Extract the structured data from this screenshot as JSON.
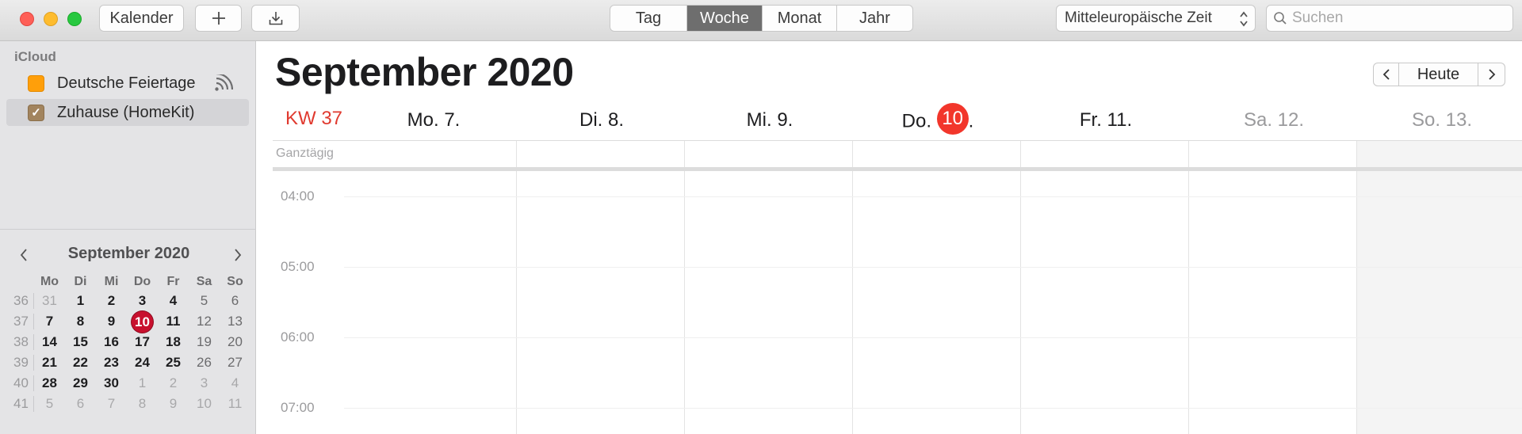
{
  "toolbar": {
    "calendars_button": "Kalender",
    "add_icon": "plus-icon",
    "import_icon": "download-tray-icon",
    "views": [
      "Tag",
      "Woche",
      "Monat",
      "Jahr"
    ],
    "active_view": "Woche",
    "timezone": "Mitteleuropäische Zeit",
    "search_placeholder": "Suchen"
  },
  "sidebar": {
    "account": "iCloud",
    "calendars": [
      {
        "name": "Deutsche Feiertage",
        "color": "#ff9f0a",
        "checked": false,
        "subscribed": true
      },
      {
        "name": "Zuhause (HomeKit)",
        "color": "#a2845e",
        "checked": true,
        "subscribed": false
      }
    ],
    "mini_calendar": {
      "title": "September 2020",
      "weekdays": [
        "Mo",
        "Di",
        "Mi",
        "Do",
        "Fr",
        "Sa",
        "So"
      ],
      "weeks": [
        {
          "wk": "36",
          "days": [
            "31",
            "1",
            "2",
            "3",
            "4",
            "5",
            "6"
          ]
        },
        {
          "wk": "37",
          "days": [
            "7",
            "8",
            "9",
            "10",
            "11",
            "12",
            "13"
          ]
        },
        {
          "wk": "38",
          "days": [
            "14",
            "15",
            "16",
            "17",
            "18",
            "19",
            "20"
          ]
        },
        {
          "wk": "39",
          "days": [
            "21",
            "22",
            "23",
            "24",
            "25",
            "26",
            "27"
          ]
        },
        {
          "wk": "40",
          "days": [
            "28",
            "29",
            "30",
            "1",
            "2",
            "3",
            "4"
          ]
        },
        {
          "wk": "41",
          "days": [
            "5",
            "6",
            "7",
            "8",
            "9",
            "10",
            "11"
          ]
        }
      ],
      "today": "10"
    }
  },
  "main": {
    "title": "September 2020",
    "today_button": "Heute",
    "week_label": "KW 37",
    "days": [
      {
        "label": "Mo. 7.",
        "weekend": false
      },
      {
        "label": "Di. 8.",
        "weekend": false
      },
      {
        "label": "Mi. 9.",
        "weekend": false
      },
      {
        "prefix": "Do.",
        "day": "10",
        "suffix": ".",
        "weekend": false,
        "today": true
      },
      {
        "label": "Fr. 11.",
        "weekend": false
      },
      {
        "label": "Sa. 12.",
        "weekend": true
      },
      {
        "label": "So. 13.",
        "weekend": true
      }
    ],
    "allday_label": "Ganztägig",
    "hours": [
      "04:00",
      "05:00",
      "06:00",
      "07:00"
    ],
    "colors": {
      "today": "#f2362b",
      "week_label": "#e03a2f",
      "active_segment": "#6e6e6e"
    }
  }
}
